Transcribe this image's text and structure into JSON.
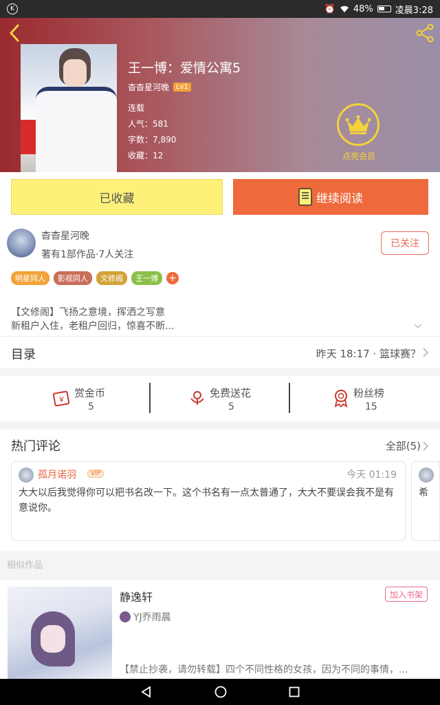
{
  "status": {
    "badge": "K",
    "battery": "48%",
    "time": "凌晨3:28"
  },
  "book": {
    "title": "王一博：爱情公寓5",
    "author": "杳杳星河晚",
    "level": "Lv1",
    "state": "连载",
    "popularity": "人气：581",
    "words": "字数：7,890",
    "favorites": "收藏：12",
    "member_label": "点亮会员"
  },
  "actions": {
    "fav_label": "已收藏",
    "read_label": "继续阅读"
  },
  "author_box": {
    "name": "杳杳星河晚",
    "stats": "著有1部作品·7人关注",
    "follow_label": "已关注",
    "tags": [
      {
        "label": "明星同人",
        "color": "#f2a33a"
      },
      {
        "label": "影视同人",
        "color": "#c96e5a"
      },
      {
        "label": "文修阁",
        "color": "#d2a23a"
      },
      {
        "label": "王一博",
        "color": "#8cbf4a"
      }
    ],
    "plus": "+"
  },
  "description": {
    "line1": "【文修阁】飞扬之意境，挥洒之写意",
    "line2": "新租户入住，老租户回归，惊喜不断..."
  },
  "toc": {
    "label": "目录",
    "latest": "昨天 18:17 · 篮球赛？"
  },
  "stats": [
    {
      "label": "赏金币",
      "value": "5",
      "icon": "coin-card-icon"
    },
    {
      "label": "免费送花",
      "value": "5",
      "icon": "flower-icon"
    },
    {
      "label": "粉丝榜",
      "value": "15",
      "icon": "medal-icon"
    }
  ],
  "reviews": {
    "heading": "热门评论",
    "all_label": "全部(5)",
    "items": [
      {
        "user": "孤月诺羽",
        "badge": "VIP",
        "time": "今天 01:19",
        "text": "大大以后我觉得你可以把书名改一下。这个书名有一点太普通了，大大不要误会我不是有意说你。"
      },
      {
        "text": "希"
      }
    ]
  },
  "similar": {
    "heading": "相似作品",
    "items": [
      {
        "title": "静逸轩",
        "shelf_label": "加入书架",
        "author": "YJ乔雨晨",
        "desc": "【禁止抄袭，请勿转载】四个不同性格的女孩，因为不同的事情，..."
      }
    ]
  },
  "colors": {
    "accent": "#ee6a3c",
    "fav_button": "#fdf17a",
    "member": "#f4d23a"
  }
}
